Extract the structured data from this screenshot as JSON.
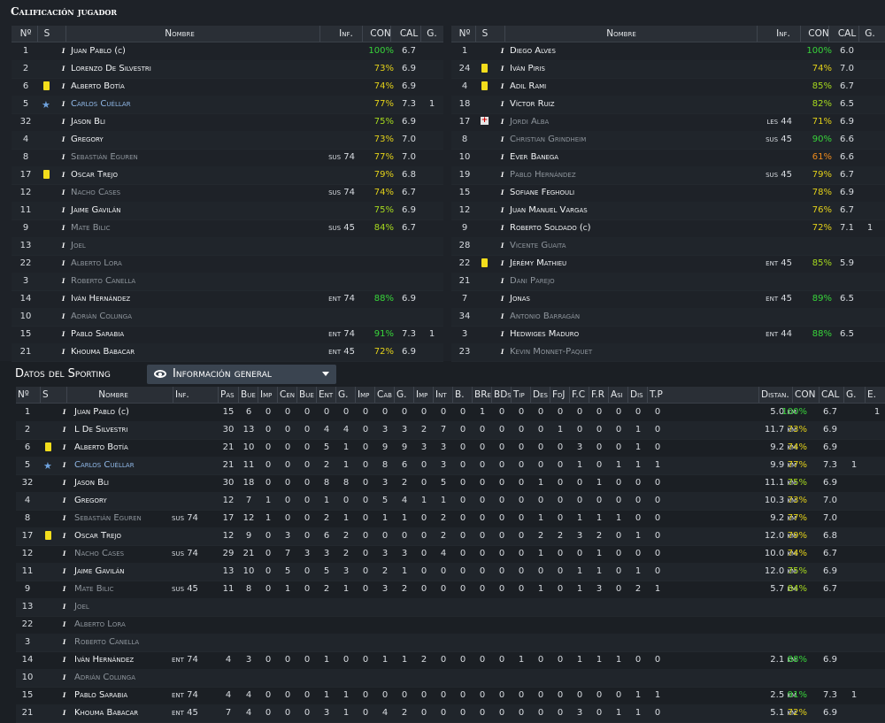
{
  "top": {
    "title": "Calificación jugador",
    "headers": {
      "num": "Nº",
      "s": "S",
      "name": "Nombre",
      "inf": "Inf.",
      "con": "CON",
      "cal": "CAL",
      "g": "G."
    },
    "left": [
      {
        "num": "1",
        "name": "Juan Pablo (c)",
        "style": "",
        "inf": "",
        "con": "100%",
        "cc": "g",
        "cal": "6.7",
        "g": "",
        "mark": ""
      },
      {
        "num": "2",
        "name": "Lorenzo De Silvestri",
        "style": "",
        "inf": "",
        "con": "73%",
        "cc": "y",
        "cal": "6.9",
        "g": "",
        "mark": ""
      },
      {
        "num": "6",
        "name": "Alberto Botía",
        "style": "",
        "inf": "",
        "con": "74%",
        "cc": "y",
        "cal": "6.9",
        "g": "",
        "mark": "card"
      },
      {
        "num": "5",
        "name": "Carlos Cuéllar",
        "style": "blue",
        "inf": "",
        "con": "77%",
        "cc": "y",
        "cal": "7.3",
        "g": "1",
        "mark": "star"
      },
      {
        "num": "32",
        "name": "Jason Bli",
        "style": "",
        "inf": "",
        "con": "75%",
        "cc": "lg",
        "cal": "6.9",
        "g": "",
        "mark": ""
      },
      {
        "num": "4",
        "name": "Gregory",
        "style": "",
        "inf": "",
        "con": "73%",
        "cc": "y",
        "cal": "7.0",
        "g": "",
        "mark": ""
      },
      {
        "num": "8",
        "name": "Sebastián Eguren",
        "style": "dim",
        "inf": "sus 74",
        "con": "77%",
        "cc": "y",
        "cal": "7.0",
        "g": "",
        "mark": ""
      },
      {
        "num": "17",
        "name": "Oscar Trejo",
        "style": "",
        "inf": "",
        "con": "79%",
        "cc": "y",
        "cal": "6.8",
        "g": "",
        "mark": "card"
      },
      {
        "num": "12",
        "name": "Nacho Cases",
        "style": "dim",
        "inf": "sus 74",
        "con": "74%",
        "cc": "y",
        "cal": "6.7",
        "g": "",
        "mark": ""
      },
      {
        "num": "11",
        "name": "Jaime Gavilán",
        "style": "",
        "inf": "",
        "con": "75%",
        "cc": "lg",
        "cal": "6.9",
        "g": "",
        "mark": ""
      },
      {
        "num": "9",
        "name": "Mate Bilic",
        "style": "dim",
        "inf": "sus 45",
        "con": "84%",
        "cc": "lg",
        "cal": "6.7",
        "g": "",
        "mark": ""
      },
      {
        "num": "13",
        "name": "Joel",
        "style": "dim",
        "inf": "",
        "con": "",
        "cc": "",
        "cal": "",
        "g": "",
        "mark": ""
      },
      {
        "num": "22",
        "name": "Alberto Lora",
        "style": "dim",
        "inf": "",
        "con": "",
        "cc": "",
        "cal": "",
        "g": "",
        "mark": ""
      },
      {
        "num": "3",
        "name": "Roberto Canella",
        "style": "dim",
        "inf": "",
        "con": "",
        "cc": "",
        "cal": "",
        "g": "",
        "mark": ""
      },
      {
        "num": "14",
        "name": "Iván Hernández",
        "style": "",
        "inf": "ent 74",
        "con": "88%",
        "cc": "g",
        "cal": "6.9",
        "g": "",
        "mark": ""
      },
      {
        "num": "10",
        "name": "Adrián Colunga",
        "style": "dim",
        "inf": "",
        "con": "",
        "cc": "",
        "cal": "",
        "g": "",
        "mark": ""
      },
      {
        "num": "15",
        "name": "Pablo Sarabia",
        "style": "",
        "inf": "ent 74",
        "con": "91%",
        "cc": "g",
        "cal": "7.3",
        "g": "1",
        "mark": ""
      },
      {
        "num": "21",
        "name": "Khouma Babacar",
        "style": "",
        "inf": "ent 45",
        "con": "72%",
        "cc": "y",
        "cal": "6.9",
        "g": "",
        "mark": ""
      }
    ],
    "right": [
      {
        "num": "1",
        "name": "Diego Alves",
        "style": "",
        "inf": "",
        "con": "100%",
        "cc": "g",
        "cal": "6.0",
        "g": "",
        "mark": ""
      },
      {
        "num": "24",
        "name": "Iván Piris",
        "style": "",
        "inf": "",
        "con": "74%",
        "cc": "y",
        "cal": "7.0",
        "g": "",
        "mark": "card"
      },
      {
        "num": "4",
        "name": "Adil Rami",
        "style": "",
        "inf": "",
        "con": "85%",
        "cc": "lg",
        "cal": "6.7",
        "g": "",
        "mark": "card"
      },
      {
        "num": "18",
        "name": "Víctor Ruiz",
        "style": "",
        "inf": "",
        "con": "82%",
        "cc": "lg",
        "cal": "6.5",
        "g": "",
        "mark": ""
      },
      {
        "num": "17",
        "name": "Jordi Alba",
        "style": "dim",
        "inf": "les 44",
        "con": "71%",
        "cc": "y",
        "cal": "6.9",
        "g": "",
        "mark": "inj"
      },
      {
        "num": "8",
        "name": "Christian Grindheim",
        "style": "dim",
        "inf": "sus 45",
        "con": "90%",
        "cc": "g",
        "cal": "6.6",
        "g": "",
        "mark": ""
      },
      {
        "num": "10",
        "name": "Ever Banega",
        "style": "",
        "inf": "",
        "con": "61%",
        "cc": "o",
        "cal": "6.6",
        "g": "",
        "mark": ""
      },
      {
        "num": "19",
        "name": "Pablo Hernández",
        "style": "dim",
        "inf": "sus 45",
        "con": "79%",
        "cc": "y",
        "cal": "6.7",
        "g": "",
        "mark": ""
      },
      {
        "num": "15",
        "name": "Sofiane Feghouli",
        "style": "",
        "inf": "",
        "con": "78%",
        "cc": "y",
        "cal": "6.9",
        "g": "",
        "mark": ""
      },
      {
        "num": "12",
        "name": "Juan Manuel Vargas",
        "style": "",
        "inf": "",
        "con": "76%",
        "cc": "y",
        "cal": "6.7",
        "g": "",
        "mark": ""
      },
      {
        "num": "9",
        "name": "Roberto Soldado (c)",
        "style": "",
        "inf": "",
        "con": "72%",
        "cc": "y",
        "cal": "7.1",
        "g": "1",
        "mark": ""
      },
      {
        "num": "28",
        "name": "Vicente Guaita",
        "style": "dim",
        "inf": "",
        "con": "",
        "cc": "",
        "cal": "",
        "g": "",
        "mark": ""
      },
      {
        "num": "22",
        "name": "Jérémy Mathieu",
        "style": "",
        "inf": "ent 45",
        "con": "85%",
        "cc": "lg",
        "cal": "5.9",
        "g": "",
        "mark": "card"
      },
      {
        "num": "21",
        "name": "Dani Parejo",
        "style": "dim",
        "inf": "",
        "con": "",
        "cc": "",
        "cal": "",
        "g": "",
        "mark": ""
      },
      {
        "num": "7",
        "name": "Jonas",
        "style": "",
        "inf": "ent 45",
        "con": "89%",
        "cc": "g",
        "cal": "6.5",
        "g": "",
        "mark": ""
      },
      {
        "num": "34",
        "name": "Antonio Barragán",
        "style": "dim",
        "inf": "",
        "con": "",
        "cc": "",
        "cal": "",
        "g": "",
        "mark": ""
      },
      {
        "num": "3",
        "name": "Hedwiges Maduro",
        "style": "",
        "inf": "ent 44",
        "con": "88%",
        "cc": "g",
        "cal": "6.5",
        "g": "",
        "mark": ""
      },
      {
        "num": "23",
        "name": "Kevin Monnet-Paquet",
        "style": "dim",
        "inf": "",
        "con": "",
        "cc": "",
        "cal": "",
        "g": "",
        "mark": ""
      }
    ]
  },
  "bottom": {
    "title": "Datos del Sporting",
    "dropdown": "Información general",
    "headers": [
      "Nº",
      "S",
      "Nombre",
      "Inf.",
      "Pas",
      "Bue",
      "Imp",
      "Cen",
      "Bue",
      "Ent",
      "G.",
      "Imp",
      "Cab",
      "G.",
      "Imp",
      "Int",
      "B.",
      "BRe",
      "BDs",
      "Tip",
      "Des",
      "FdJ",
      "F.C",
      "F.R",
      "Asi",
      "Dis",
      "T.P",
      "Distan.",
      "CON",
      "CAL",
      "G.",
      "E."
    ],
    "rows": [
      {
        "num": "1",
        "name": "Juan Pablo (c)",
        "style": "",
        "mark": "",
        "inf": "",
        "stats": [
          "15",
          "6",
          "0",
          "0",
          "0",
          "0",
          "0",
          "0",
          "0",
          "0",
          "0",
          "0",
          "0",
          "1",
          "0",
          "0",
          "0",
          "0",
          "0",
          "0",
          "0",
          "0",
          "0"
        ],
        "dist": "5.0 km",
        "con": "100%",
        "cc": "g",
        "cal": "6.7",
        "g": "",
        "e": "1"
      },
      {
        "num": "2",
        "name": "L De Silvestri",
        "style": "",
        "mark": "",
        "inf": "",
        "stats": [
          "30",
          "13",
          "0",
          "0",
          "0",
          "4",
          "4",
          "0",
          "3",
          "3",
          "2",
          "7",
          "0",
          "0",
          "0",
          "0",
          "0",
          "1",
          "0",
          "0",
          "0",
          "1",
          "0"
        ],
        "dist": "11.7 km",
        "con": "73%",
        "cc": "y",
        "cal": "6.9",
        "g": "",
        "e": ""
      },
      {
        "num": "6",
        "name": "Alberto Botía",
        "style": "",
        "mark": "card",
        "inf": "",
        "stats": [
          "21",
          "10",
          "0",
          "0",
          "0",
          "5",
          "1",
          "0",
          "9",
          "9",
          "3",
          "3",
          "0",
          "0",
          "0",
          "0",
          "0",
          "0",
          "3",
          "0",
          "0",
          "1",
          "0"
        ],
        "dist": "9.2 km",
        "con": "74%",
        "cc": "y",
        "cal": "6.9",
        "g": "",
        "e": ""
      },
      {
        "num": "5",
        "name": "Carlos Cuéllar",
        "style": "blue",
        "mark": "star",
        "inf": "",
        "stats": [
          "21",
          "11",
          "0",
          "0",
          "0",
          "2",
          "1",
          "0",
          "8",
          "6",
          "0",
          "3",
          "0",
          "0",
          "0",
          "0",
          "0",
          "0",
          "1",
          "0",
          "1",
          "1",
          "1"
        ],
        "dist": "9.9 km",
        "con": "77%",
        "cc": "y",
        "cal": "7.3",
        "g": "1",
        "e": ""
      },
      {
        "num": "32",
        "name": "Jason Bli",
        "style": "",
        "mark": "",
        "inf": "",
        "stats": [
          "30",
          "18",
          "0",
          "0",
          "0",
          "8",
          "8",
          "0",
          "3",
          "2",
          "0",
          "5",
          "0",
          "0",
          "0",
          "0",
          "1",
          "0",
          "0",
          "1",
          "0",
          "0",
          "0"
        ],
        "dist": "11.1 km",
        "con": "75%",
        "cc": "lg",
        "cal": "6.9",
        "g": "",
        "e": ""
      },
      {
        "num": "4",
        "name": "Gregory",
        "style": "",
        "mark": "",
        "inf": "",
        "stats": [
          "12",
          "7",
          "1",
          "0",
          "0",
          "1",
          "0",
          "0",
          "5",
          "4",
          "1",
          "1",
          "0",
          "0",
          "0",
          "0",
          "0",
          "0",
          "0",
          "0",
          "0",
          "0",
          "0"
        ],
        "dist": "10.3 km",
        "con": "73%",
        "cc": "y",
        "cal": "7.0",
        "g": "",
        "e": ""
      },
      {
        "num": "8",
        "name": "Sebastián Eguren",
        "style": "dim",
        "mark": "",
        "inf": "sus 74",
        "stats": [
          "17",
          "12",
          "1",
          "0",
          "0",
          "2",
          "1",
          "0",
          "1",
          "1",
          "0",
          "2",
          "0",
          "0",
          "0",
          "0",
          "1",
          "0",
          "1",
          "1",
          "1",
          "0",
          "0"
        ],
        "dist": "9.2 km",
        "con": "77%",
        "cc": "y",
        "cal": "7.0",
        "g": "",
        "e": ""
      },
      {
        "num": "17",
        "name": "Oscar Trejo",
        "style": "",
        "mark": "card",
        "inf": "",
        "stats": [
          "12",
          "9",
          "0",
          "3",
          "0",
          "6",
          "2",
          "0",
          "0",
          "0",
          "0",
          "2",
          "0",
          "0",
          "0",
          "0",
          "2",
          "2",
          "3",
          "2",
          "0",
          "1",
          "0"
        ],
        "dist": "12.0 km",
        "con": "79%",
        "cc": "y",
        "cal": "6.8",
        "g": "",
        "e": ""
      },
      {
        "num": "12",
        "name": "Nacho Cases",
        "style": "dim",
        "mark": "",
        "inf": "sus 74",
        "stats": [
          "29",
          "21",
          "0",
          "7",
          "3",
          "3",
          "2",
          "0",
          "3",
          "3",
          "0",
          "4",
          "0",
          "0",
          "0",
          "0",
          "1",
          "0",
          "0",
          "1",
          "0",
          "0",
          "0"
        ],
        "dist": "10.0 km",
        "con": "74%",
        "cc": "y",
        "cal": "6.7",
        "g": "",
        "e": ""
      },
      {
        "num": "11",
        "name": "Jaime Gavilán",
        "style": "",
        "mark": "",
        "inf": "",
        "stats": [
          "13",
          "10",
          "0",
          "5",
          "0",
          "5",
          "3",
          "0",
          "2",
          "1",
          "0",
          "0",
          "0",
          "0",
          "0",
          "0",
          "0",
          "0",
          "1",
          "1",
          "0",
          "1",
          "0"
        ],
        "dist": "12.0 km",
        "con": "75%",
        "cc": "lg",
        "cal": "6.9",
        "g": "",
        "e": ""
      },
      {
        "num": "9",
        "name": "Mate Bilic",
        "style": "dim",
        "mark": "",
        "inf": "sus 45",
        "stats": [
          "11",
          "8",
          "0",
          "1",
          "0",
          "2",
          "1",
          "0",
          "3",
          "2",
          "0",
          "0",
          "0",
          "0",
          "0",
          "0",
          "1",
          "0",
          "1",
          "3",
          "0",
          "2",
          "1"
        ],
        "dist": "5.7 km",
        "con": "84%",
        "cc": "lg",
        "cal": "6.7",
        "g": "",
        "e": ""
      },
      {
        "num": "13",
        "name": "Joel",
        "style": "dim",
        "mark": "",
        "inf": "",
        "stats": [],
        "dist": "",
        "con": "",
        "cc": "",
        "cal": "",
        "g": "",
        "e": ""
      },
      {
        "num": "22",
        "name": "Alberto Lora",
        "style": "dim",
        "mark": "",
        "inf": "",
        "stats": [],
        "dist": "",
        "con": "",
        "cc": "",
        "cal": "",
        "g": "",
        "e": ""
      },
      {
        "num": "3",
        "name": "Roberto Canella",
        "style": "dim",
        "mark": "",
        "inf": "",
        "stats": [],
        "dist": "",
        "con": "",
        "cc": "",
        "cal": "",
        "g": "",
        "e": ""
      },
      {
        "num": "14",
        "name": "Iván Hernández",
        "style": "",
        "mark": "",
        "inf": "ent 74",
        "stats": [
          "4",
          "3",
          "0",
          "0",
          "0",
          "1",
          "0",
          "0",
          "1",
          "1",
          "2",
          "0",
          "0",
          "0",
          "0",
          "1",
          "0",
          "0",
          "1",
          "1",
          "1",
          "0",
          "0"
        ],
        "dist": "2.1 km",
        "con": "88%",
        "cc": "g",
        "cal": "6.9",
        "g": "",
        "e": ""
      },
      {
        "num": "10",
        "name": "Adrián Colunga",
        "style": "dim",
        "mark": "",
        "inf": "",
        "stats": [],
        "dist": "",
        "con": "",
        "cc": "",
        "cal": "",
        "g": "",
        "e": ""
      },
      {
        "num": "15",
        "name": "Pablo Sarabia",
        "style": "",
        "mark": "",
        "inf": "ent 74",
        "stats": [
          "4",
          "4",
          "0",
          "0",
          "0",
          "1",
          "1",
          "0",
          "0",
          "0",
          "0",
          "0",
          "0",
          "0",
          "0",
          "0",
          "0",
          "0",
          "0",
          "0",
          "0",
          "1",
          "1"
        ],
        "dist": "2.5 km",
        "con": "91%",
        "cc": "g",
        "cal": "7.3",
        "g": "1",
        "e": ""
      },
      {
        "num": "21",
        "name": "Khouma Babacar",
        "style": "",
        "mark": "",
        "inf": "ent 45",
        "stats": [
          "7",
          "4",
          "0",
          "0",
          "0",
          "3",
          "1",
          "0",
          "4",
          "2",
          "0",
          "0",
          "0",
          "0",
          "0",
          "0",
          "0",
          "0",
          "3",
          "0",
          "1",
          "1",
          "0"
        ],
        "dist": "5.1 km",
        "con": "72%",
        "cc": "y",
        "cal": "6.9",
        "g": "",
        "e": ""
      }
    ]
  }
}
